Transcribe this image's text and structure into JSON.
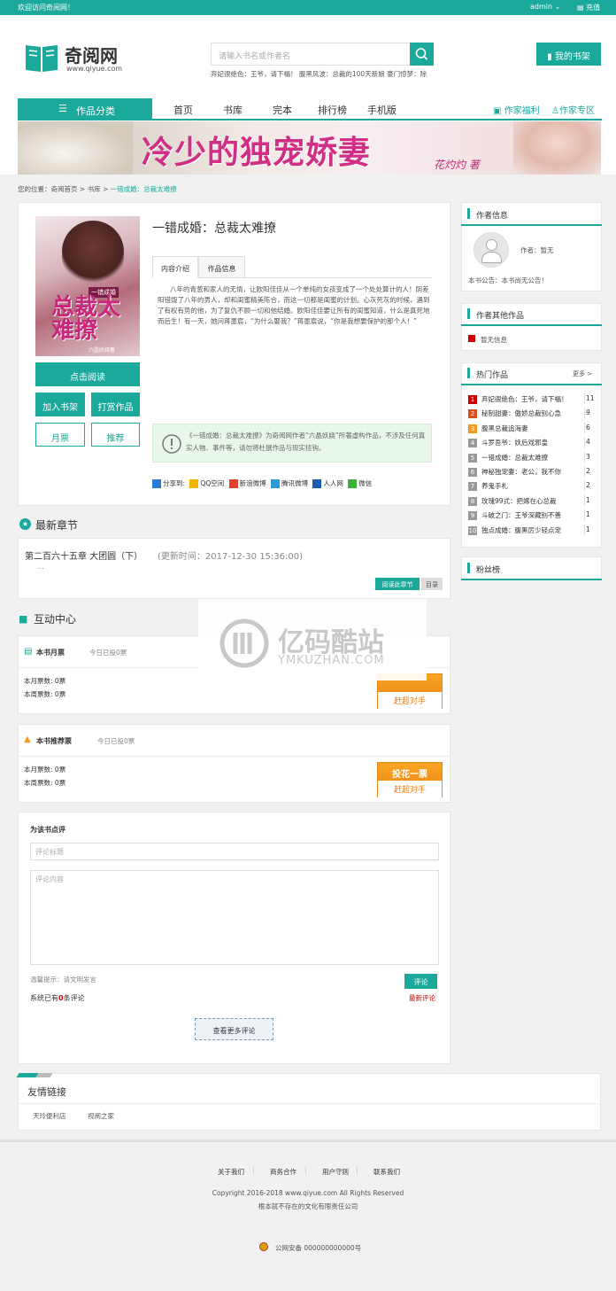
{
  "topbar": {
    "welcome": "欢迎访问奇阅网！",
    "user": "admin",
    "recharge": "充值"
  },
  "logo": {
    "name": "奇阅网",
    "url": "www.qiyue.com"
  },
  "search": {
    "placeholder": "请输入书名或作者名",
    "hot": "弃妃很绝色：王爷，请下榻！ 腹黑风波：总裁的100天新娘 豪门惊梦：除"
  },
  "header": {
    "my_bookshelf": "我的书架"
  },
  "nav": {
    "category": "作品分类",
    "items": [
      "首页",
      "书库",
      "完本",
      "排行榜",
      "手机版"
    ],
    "right": [
      "作家福利",
      "作家专区"
    ]
  },
  "banner": {
    "title": "冷少的独宠娇妻",
    "author": "花灼灼 著"
  },
  "breadcrumb": {
    "prefix": "您的位置：",
    "items": [
      "奇阅首页",
      "书库"
    ],
    "current": "一错成婚：总裁太难撩",
    "sep": ">"
  },
  "book": {
    "title": "一错成婚：总裁太难撩",
    "cover_title": "总裁太难撩",
    "cover_sub": "一错成婚",
    "cover_author": "六晶妖娆著",
    "tabs": [
      "内容介绍",
      "作品信息"
    ],
    "intro": "八年的青葱和家人的无情，让欧阳佳佳从一个单纯的女孩变成了一个处处算计的人！阴差阳错毁了八年的男人，却和闺蜜精美陈合，而这一切都是闺蜜的计划。心灰死灰的时候，遇到了有权有势的他，为了复仇不顾一切和他结婚。欧阳佳佳要让所有的闺蜜知道，什么是真死地而后生！有一天，她问蒋墨宸，“为什么娶我？”蒋墨宸说，“你是我想要保护的那个人！”",
    "read": "点击阅读",
    "add_shelf": "加入书架",
    "reward": "打赏作品",
    "monthly": "月票",
    "recommend": "推荐",
    "notice": "《一错成婚：总裁太难撩》为奇阅网作者“六晶妖娆”所著虚构作品，不涉及任何真实人物、事件等，请勿将杜撰作品与现实挂钩。",
    "share_label": "分享到:",
    "share": [
      "QQ空间",
      "新浪微博",
      "腾讯微博",
      "人人网",
      "微信"
    ]
  },
  "latest": {
    "heading": "最新章节",
    "chapter": "第二百六十五章 大团圆（下）",
    "update": "(更新时间：2017-12-30 15:36:00)",
    "ellipsis": "...",
    "read_chapter": "阅读此章节",
    "catalog": "目录"
  },
  "interact": {
    "heading": "互动中心"
  },
  "monthly_ticket": {
    "title": "本书月票",
    "today": "今日已投0票",
    "month_label": "本月票数: ",
    "month_val": "0票",
    "week_label": "本周票数: ",
    "week_val": "0票",
    "btn_bottom": "赶超对手"
  },
  "recommend_ticket": {
    "title": "本书推荐票",
    "today": "今日已投0票",
    "month_label": "本月票数: ",
    "month_val": "0票",
    "week_label": "本周票数: ",
    "week_val": "0票",
    "btn_top": "投花一票",
    "btn_bottom": "赶超对手"
  },
  "review": {
    "title": "为该书点评",
    "title_placeholder": "评论标题",
    "content_placeholder": "评论内容",
    "tip": "温馨提示：请文明发言",
    "submit": "评论",
    "count_pre": "系统已有",
    "count": "0",
    "count_post": "条评论",
    "latest": "最新评论",
    "more": "查看更多评论"
  },
  "friends": {
    "title": "友情链接",
    "links": [
      "天玲便利店",
      "视阅之家"
    ]
  },
  "sidebar": {
    "author_info": "作者信息",
    "author_label": "作者：",
    "author_name": "暂无",
    "author_notice": "本书公告：本书尚无公告！",
    "other_works": "作者其他作品",
    "no_info": "暂无信息",
    "hot_works": "热门作品",
    "more": "更多 >",
    "hot": [
      {
        "rank": "1",
        "title": "弃妃很绝色：王爷，请下榻！",
        "count": "11"
      },
      {
        "rank": "2",
        "title": "秘制甜妻：傲娇总裁别心急",
        "count": "9"
      },
      {
        "rank": "3",
        "title": "腹黑总裁追海妻",
        "count": "6"
      },
      {
        "rank": "4",
        "title": "斗罗吾爷：妖后戏邪皇",
        "count": "4"
      },
      {
        "rank": "5",
        "title": "一错成婚：总裁太难撩",
        "count": "3"
      },
      {
        "rank": "6",
        "title": "神秘独宠妻：老公，我不你",
        "count": "2"
      },
      {
        "rank": "7",
        "title": "养鬼手札",
        "count": "2"
      },
      {
        "rank": "8",
        "title": "玫瑰99式：把嫁在心总裁",
        "count": "1"
      },
      {
        "rank": "9",
        "title": "斗破之门：王爷深藏别不善",
        "count": "1"
      },
      {
        "rank": "10",
        "title": "独点成婚：腹黑厉少轻点宠",
        "count": "1"
      }
    ],
    "fans": "粉丝榜"
  },
  "footer": {
    "links": [
      "关于我们",
      "商务合作",
      "用户守则",
      "联系我们"
    ],
    "copyright": "Copyright 2016-2018 www.qiyue.com All Rights Reserved",
    "company": "根本就不存在的文化有限责任公司",
    "police": "公网安备 000000000000号"
  },
  "watermark": {
    "cn": "亿码酷站",
    "en": "YMKUZHAN.COM"
  },
  "colors": {
    "primary": "#1aa99a",
    "orange": "#f39a1e",
    "red": "#cc0000"
  }
}
